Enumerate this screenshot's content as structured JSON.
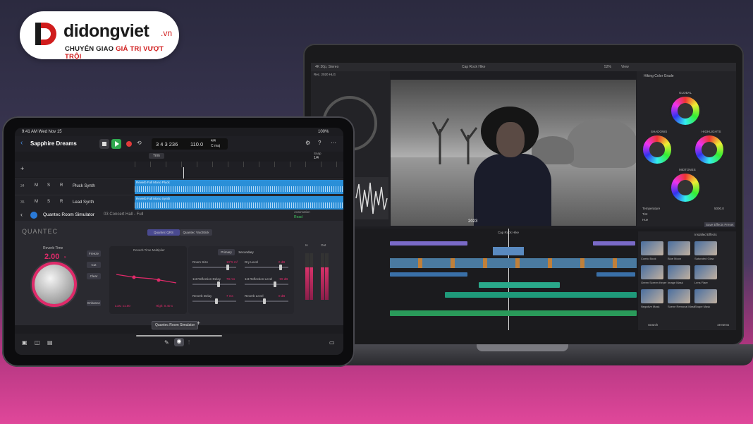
{
  "brand": {
    "name": "didongviet",
    "suffix": ".vn",
    "tagline_part1": "CHUYỂN GIAO",
    "tagline_part2": "GIÁ TRỊ VƯỢT TRỘI",
    "colors": {
      "red": "#d01c1c",
      "dark": "#1a1a1a"
    }
  },
  "ipad": {
    "status": {
      "time": "9:41 AM  Wed Nov 15",
      "battery": "100%"
    },
    "project_title": "Sapphire Dreams",
    "lcd": {
      "position": "3 4 3 236",
      "tempo": "110.0",
      "signature": "4/4",
      "key": "C maj"
    },
    "snap_label": "Snap",
    "snap_value": "1/4",
    "trim_label": "Trim",
    "tracks": [
      {
        "number": "34",
        "name": "Pluck Synth",
        "region": "Reverb Full Mono Pluck"
      },
      {
        "number": "35",
        "name": "Lead Synth",
        "region": "Reverb Full Mono Synth"
      }
    ],
    "plugin": {
      "title": "Quantec Room Simulator",
      "preset": "03 Concert Hall - Full",
      "automation_label": "Automation",
      "automation_value": "Read",
      "brand": "QUANTEC",
      "tabs": [
        "Quantec QRS",
        "Quantec YardStick"
      ],
      "reverb_time_label": "Reverb Time",
      "reverb_time_value": "2.00",
      "reverb_time_unit": "s",
      "rtm_label": "Reverb Time Multiplier",
      "mode_tabs": [
        "Primary",
        "Secondary"
      ],
      "buttons": [
        "Freeze",
        "Cut",
        "Clear",
        "Enhance"
      ],
      "params": [
        {
          "label": "Room Size",
          "value": "10^5 m³",
          "level": 0.82
        },
        {
          "label": "1st Reflection Delay",
          "value": "78 ms",
          "level": 0.6
        },
        {
          "label": "Reverb Delay",
          "value": "7 ms",
          "level": 0.55
        },
        {
          "label": "Dry Level",
          "value": "0 dB",
          "level": 0.85
        },
        {
          "label": "1st Reflection Level",
          "value": "-99 dB",
          "level": 0.7
        },
        {
          "label": "Reverb Level",
          "value": "0 dB",
          "level": 0.45
        }
      ],
      "low_label": "Low: x1.00",
      "high_label": "High: 0.40 x",
      "meter_labels": [
        "In",
        "Out"
      ],
      "meter_levels": [
        0.7,
        0.7
      ]
    },
    "bottom_tab": "Quantec Room Simulator"
  },
  "mac": {
    "fcp": {
      "format": "4K 30p, Stereo",
      "project": "Cap Rock Hike",
      "zoom": "52%",
      "view_label": "View",
      "inspector_title": "Hiking Color Grade",
      "wheel_labels": [
        "GLOBAL",
        "SHADOWS",
        "HIGHLIGHTS",
        "MIDTONES"
      ],
      "param_labels": [
        "Temperature",
        "Tint",
        "Hue"
      ],
      "temperature_value": "5000.0",
      "save_effects_preset": "Save Effects Preset",
      "library_label": "Rec. 2020 HLG",
      "timecode": "2023",
      "timeline_project": "Cap Rock Hike",
      "installed_effects": "Installed Effects",
      "effects": [
        "Comic Book",
        "Blue Moon",
        "Saturated Glow",
        "Green Screen Keyer",
        "Image Mask",
        "Lens Flare",
        "Negative Mask",
        "Scene Removal Mask",
        "Shape Mask"
      ],
      "search_placeholder": "Search",
      "items_count": "19 Items"
    }
  }
}
